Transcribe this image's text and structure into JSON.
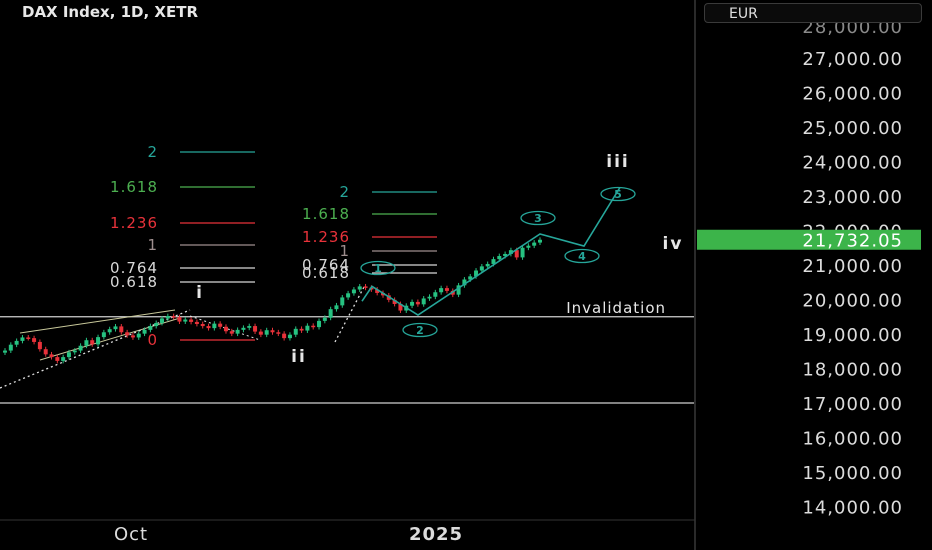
{
  "header": {
    "symbol": "DAX Index, 1D, XETR",
    "currency": "EUR"
  },
  "colors": {
    "background": "#000000",
    "up": "#26c281",
    "down": "#e8323a",
    "wave": "#26a69a",
    "price_tag": "#3cb44a",
    "grid_line": "#d0d0d0",
    "fib_2": "#26a69a",
    "fib_1618": "#4caf50",
    "fib_1236": "#e8323a",
    "fib_1": "#9e8e8e",
    "fib_0764": "#d8d8d8",
    "fib_0618": "#d8d8d8"
  },
  "chart_data": {
    "type": "line",
    "title": "DAX Index, 1D, XETR",
    "xlabel": "",
    "ylabel": "",
    "ylim": [
      13600,
      28700
    ],
    "x_tick_labels": [
      "Oct",
      "2025"
    ],
    "y_tick_labels": [
      "27,000.00",
      "26,000.00",
      "25,000.00",
      "24,000.00",
      "23,000.00",
      "22,000.00",
      "21,000.00",
      "20,000.00",
      "19,000.00",
      "18,000.00",
      "17,000.00",
      "16,000.00",
      "15,000.00",
      "14,000.00"
    ],
    "last_price": 21732.05,
    "last_price_label": "21,732.05",
    "horizontal_lines": [
      {
        "label": "Invalidation",
        "value": 19500
      },
      {
        "label": "",
        "value": 17000
      }
    ],
    "wave_labels": [
      "i",
      "ii",
      "iii",
      "iv"
    ],
    "circled_labels": [
      "1",
      "2",
      "3",
      "4",
      "5"
    ],
    "fib_set_1": {
      "levels": [
        {
          "label": "2",
          "value": 24250
        },
        {
          "label": "1.618",
          "value": 23200
        },
        {
          "label": "1.236",
          "value": 22150
        },
        {
          "label": "1",
          "value": 21500
        },
        {
          "label": "0.764",
          "value": 20850
        },
        {
          "label": "0.618",
          "value": 20450
        },
        {
          "label": "0",
          "value": 18700
        }
      ]
    },
    "fib_set_2": {
      "levels": [
        {
          "label": "2",
          "value": 22950
        },
        {
          "label": "1.618",
          "value": 22350
        },
        {
          "label": "1.236",
          "value": 21800
        },
        {
          "label": "1",
          "value": 21400
        },
        {
          "label": "0.764",
          "value": 20950
        },
        {
          "label": "0.618",
          "value": 20750
        }
      ]
    },
    "closes": [
      18520,
      18690,
      18800,
      18900,
      18880,
      18770,
      18560,
      18410,
      18330,
      18220,
      18330,
      18470,
      18520,
      18660,
      18820,
      18700,
      18910,
      19050,
      19140,
      19220,
      19050,
      18960,
      18900,
      19010,
      19120,
      19230,
      19320,
      19450,
      19520,
      19490,
      19360,
      19420,
      19350,
      19290,
      19230,
      19170,
      19300,
      19210,
      19080,
      19010,
      19120,
      19180,
      19230,
      19070,
      18980,
      19110,
      19050,
      19010,
      18880,
      18980,
      19150,
      19100,
      19240,
      19200,
      19380,
      19470,
      19720,
      19830,
      20060,
      20180,
      20290,
      20380,
      20340,
      20290,
      20190,
      20120,
      19990,
      19870,
      19680,
      19820,
      19930,
      19860,
      20030,
      20080,
      20210,
      20330,
      20250,
      20140,
      20410,
      20580,
      20670,
      20840,
      20960,
      21030,
      21170,
      21260,
      21320,
      21430,
      21220,
      21500,
      21560,
      21650,
      21732
    ],
    "wave_projection": [
      {
        "label": "1",
        "value": 20380
      },
      {
        "label": "2",
        "value": 19550
      },
      {
        "label": "3",
        "value": 21900
      },
      {
        "label": "4",
        "value": 21550
      },
      {
        "label": "5",
        "value": 23250
      }
    ]
  }
}
